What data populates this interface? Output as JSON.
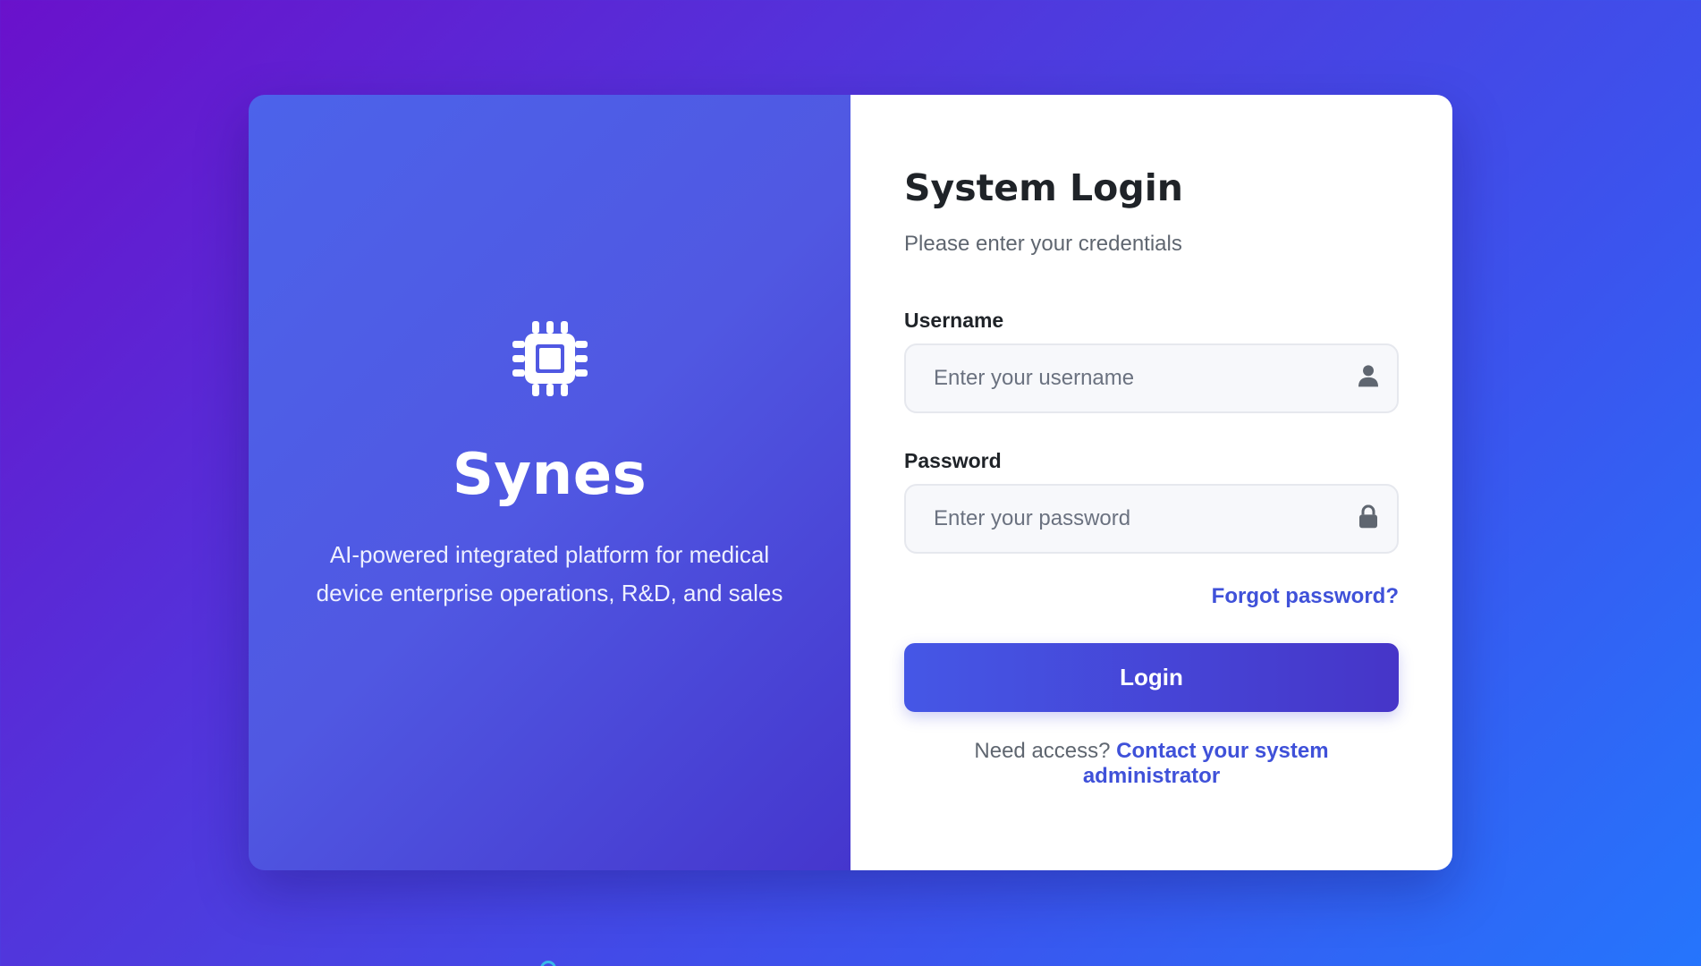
{
  "brand": {
    "icon": "cpu-chip-icon",
    "name": "Synes",
    "tagline": "AI-powered integrated platform for medical device enterprise operations, R&D, and sales"
  },
  "login_form": {
    "title": "System Login",
    "subtitle": "Please enter your credentials",
    "username": {
      "label": "Username",
      "value": "",
      "placeholder": "Enter your username",
      "icon": "user-icon"
    },
    "password": {
      "label": "Password",
      "value": "",
      "placeholder": "Enter your password",
      "icon": "lock-icon"
    },
    "forgot_label": "Forgot password?",
    "login_label": "Login",
    "access_text": "Need access?",
    "access_link": "Contact your system administrator"
  },
  "colors": {
    "background_start": "#6a11cb",
    "background_end": "#2575fc",
    "accent": "#3f51d9",
    "brand_panel": "#5058e2"
  }
}
